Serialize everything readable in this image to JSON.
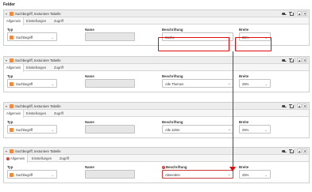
{
  "section_title": "Felder",
  "icons": {
    "field_type": "search-term-icon",
    "caret": "caret-down-icon",
    "toggle": "toggle-icon",
    "trash": "trash-icon",
    "up": "arrow-up-icon",
    "down": "arrow-down-icon",
    "error": "error-icon"
  },
  "colors": {
    "accent_red": "#e10a0a",
    "type_icon_orange": "#f08a3c",
    "error_red": "#c83c3c"
  },
  "controls": {
    "up": "▲",
    "down": "▼",
    "caret": "▾",
    "chevron": "⌄",
    "clear": "×",
    "error_mark": "!"
  },
  "labels": {
    "typ": "Typ",
    "name": "Name",
    "beschriftung": "Beschriftung",
    "breite": "Breite"
  },
  "panels": [
    {
      "title": "Suchbegriff, textuniere Tabelle",
      "tabs": [
        "Allgemein",
        "Einstellungen",
        "Zugriff"
      ],
      "type": "Suchbegriff",
      "name": "",
      "beschriftung": "Suche",
      "breite": "25%",
      "error": false
    },
    {
      "title": "Suchbegriff, textuniere Tabelle",
      "tabs": [
        "Allgemein",
        "Einstellungen",
        "Zugriff"
      ],
      "type": "Suchbegriff",
      "name": "",
      "beschriftung": "Alle Themen",
      "breite": "25%",
      "error": false
    },
    {
      "title": "Suchbegriff, textuniere Tabelle",
      "tabs": [
        "Allgemein",
        "Einstellungen",
        "Zugriff"
      ],
      "type": "Suchbegriff",
      "name": "",
      "beschriftung": "Alle Jahre",
      "breite": "25%",
      "error": false
    },
    {
      "title": "Suchbegriff, textuniere Tabelle",
      "tabs": [
        "Allgemein",
        "Einstellungen",
        "Zugriff"
      ],
      "type": "Suchbegriff",
      "name": "",
      "beschriftung": "Absenden",
      "breite": "25%",
      "error": true
    }
  ]
}
